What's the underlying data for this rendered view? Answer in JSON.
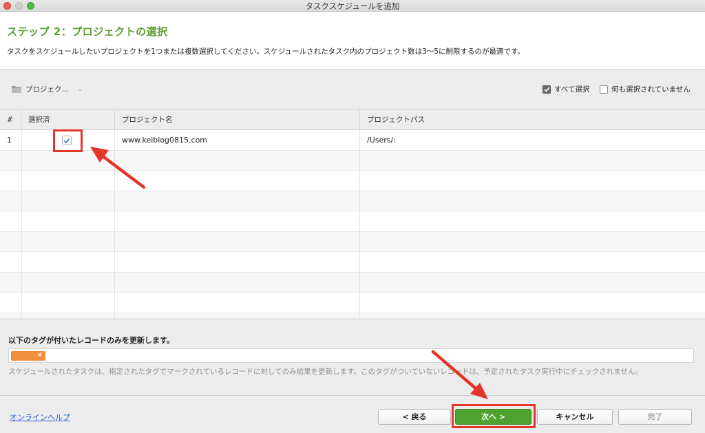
{
  "window": {
    "title": "タスクスケジュールを追加"
  },
  "header": {
    "step_title": "ステップ 2：プロジェクトの選択",
    "description": "タスクをスケジュールしたいプロジェクトを1つまたは複数選択してください。スケジュールされたタスク内のプロジェクト数は3〜5に制限するのが最適です。"
  },
  "toolbar": {
    "project_dropdown": "プロジェク...",
    "select_all": {
      "label": "すべて選択",
      "checked": true
    },
    "select_none": {
      "label": "何も選択されていません",
      "checked": false
    }
  },
  "table": {
    "columns": [
      "#",
      "選択済",
      "プロジェクト名",
      "プロジェクトパス"
    ],
    "rows": [
      {
        "index": "1",
        "selected": true,
        "name": "www.keiblog0815.com",
        "path": "/Users/:"
      }
    ]
  },
  "tags": {
    "title": "以下のタグが付いたレコードのみを更新します。",
    "chip_remove": "✕",
    "description": "スケジュールされたタスクは、指定されたタグでマークされているレコードに対してのみ結果を更新します。このタグがついていないレコードは、予定されたタスク実行中にチェックされません。"
  },
  "footer": {
    "help": "オンラインヘルプ",
    "back": "< 戻る",
    "next": "次へ >",
    "cancel": "キャンセル",
    "done": "完了"
  },
  "colors": {
    "accent_green": "#5a9e30",
    "button_green": "#4ea32f",
    "tag_orange": "#f0903e",
    "annotation_red": "#e3352a"
  }
}
